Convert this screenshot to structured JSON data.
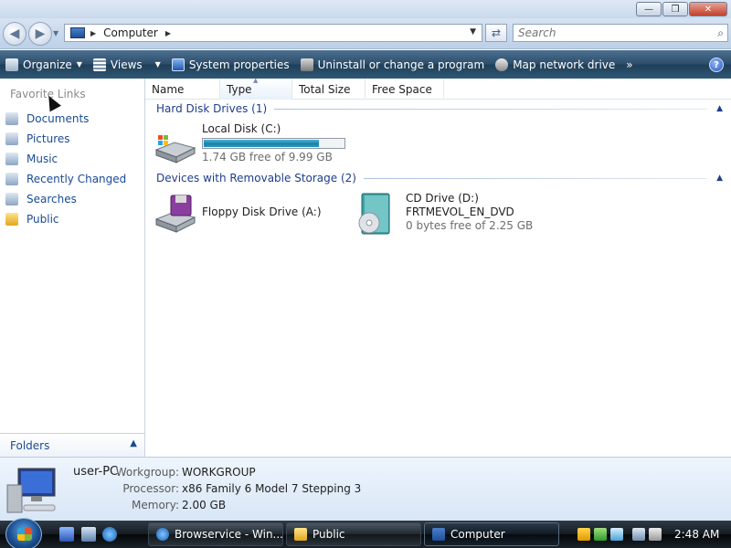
{
  "window": {
    "controls": [
      "minimize",
      "maximize",
      "close"
    ]
  },
  "address": {
    "path": "Computer",
    "search_placeholder": "Search"
  },
  "commands": [
    {
      "label": "Organize",
      "has_dropdown": true
    },
    {
      "label": "Views",
      "has_dropdown": true
    },
    {
      "label": "System properties"
    },
    {
      "label": "Uninstall or change a program"
    },
    {
      "label": "Map network drive"
    }
  ],
  "nav": {
    "heading": "Favorite Links",
    "items": [
      "Documents",
      "Pictures",
      "Music",
      "Recently Changed",
      "Searches",
      "Public"
    ],
    "folders_label": "Folders"
  },
  "columns": [
    "Name",
    "Type",
    "Total Size",
    "Free Space"
  ],
  "groups": {
    "hard_disks": "Hard Disk Drives (1)",
    "removable": "Devices with Removable Storage (2)"
  },
  "drives": {
    "local": {
      "name": "Local Disk (C:)",
      "free_text": "1.74 GB free of 9.99 GB",
      "used_fraction": 0.826
    },
    "floppy": {
      "name": "Floppy Disk Drive (A:)"
    },
    "cd": {
      "name": "CD Drive (D:)",
      "label": "FRTMEVOL_EN_DVD",
      "free_text": "0 bytes free of 2.25 GB"
    }
  },
  "details": {
    "pc_name": "user-PC",
    "workgroup_label": "Workgroup:",
    "workgroup": "WORKGROUP",
    "processor_label": "Processor:",
    "processor": "x86 Family 6 Model 7 Stepping 3",
    "memory_label": "Memory:",
    "memory": "2.00 GB"
  },
  "taskbar": {
    "buttons": [
      "Browservice - Win...",
      "Public",
      "Computer"
    ],
    "clock": "2:48 AM"
  },
  "colors": {
    "link_blue": "#1a4a94",
    "group_blue": "#1e3e8c",
    "progress": "#2b9ac5"
  }
}
